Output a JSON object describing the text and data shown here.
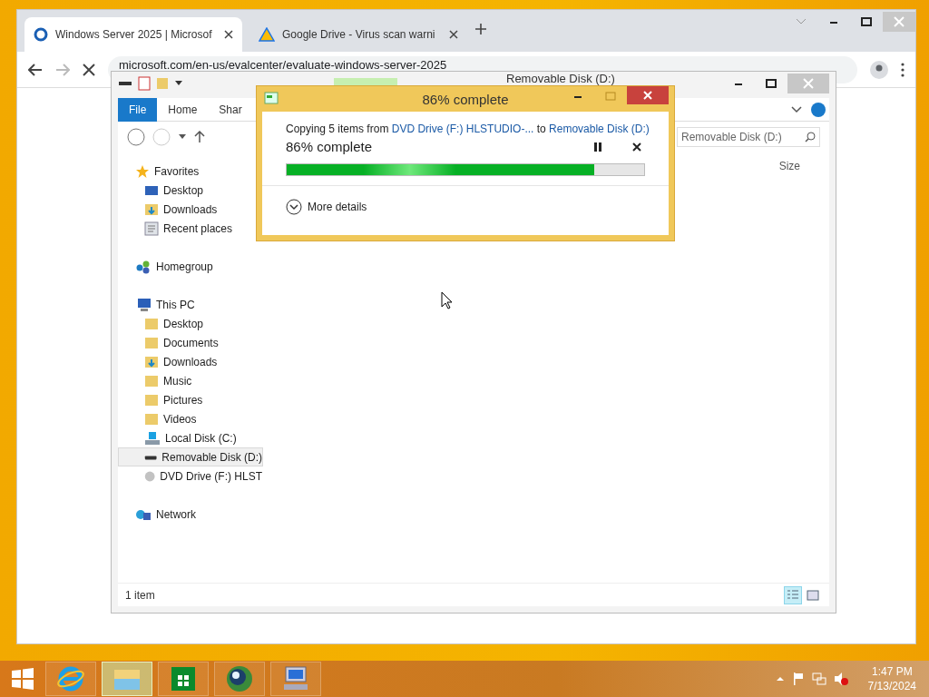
{
  "browser": {
    "tabs": [
      {
        "title": "Windows Server 2025 | Microsof",
        "selected": true,
        "kind": "ring"
      },
      {
        "title": "Google Drive - Virus scan warni",
        "selected": false,
        "kind": "drive"
      }
    ],
    "url": "microsoft.com/en-us/evalcenter/evaluate-windows-server-2025"
  },
  "explorer": {
    "title": "Removable Disk (D:)",
    "ribbon_tabs": [
      {
        "label": "File",
        "selected": true
      },
      {
        "label": "Home",
        "selected": false
      },
      {
        "label": "Shar",
        "selected": false
      }
    ],
    "search": {
      "placeholder": "Removable Disk (D:)"
    },
    "columns": [
      "Size"
    ],
    "nav": [
      {
        "label": "Favorites",
        "kind": "star",
        "selected": false,
        "children": [
          {
            "label": "Desktop",
            "kind": "desktop",
            "selected": false
          },
          {
            "label": "Downloads",
            "kind": "downloads",
            "selected": false
          },
          {
            "label": "Recent places",
            "kind": "recent",
            "selected": false
          }
        ]
      },
      {
        "label": "Homegroup",
        "kind": "homegroup",
        "selected": false
      },
      {
        "label": "This PC",
        "kind": "pc",
        "selected": false,
        "children": [
          {
            "label": "Desktop",
            "kind": "folder",
            "selected": false
          },
          {
            "label": "Documents",
            "kind": "folder",
            "selected": false
          },
          {
            "label": "Downloads",
            "kind": "downloads",
            "selected": false
          },
          {
            "label": "Music",
            "kind": "folder",
            "selected": false
          },
          {
            "label": "Pictures",
            "kind": "folder",
            "selected": false
          },
          {
            "label": "Videos",
            "kind": "folder",
            "selected": false
          },
          {
            "label": "Local Disk (C:)",
            "kind": "windisk",
            "selected": false
          },
          {
            "label": "Removable Disk (D:)",
            "kind": "removable",
            "selected": true
          },
          {
            "label": "DVD Drive (F:) HLST",
            "kind": "dvd",
            "selected": false
          }
        ]
      },
      {
        "label": "Network",
        "kind": "network",
        "selected": false
      }
    ],
    "status": "1 item",
    "views": [
      {
        "kind": "details",
        "selected": true
      },
      {
        "kind": "tiles",
        "selected": false
      }
    ]
  },
  "dialog": {
    "title": "86% complete",
    "prefix": "Copying 5 items from ",
    "source": "DVD Drive (F:) HLSTUDIO-...",
    "middle": " to ",
    "destination": "Removable Disk (D:)",
    "heading": "86% complete",
    "level": 0.86,
    "more": "More details"
  },
  "taskbar": {
    "apps": [
      {
        "kind": "ie",
        "selected": false
      },
      {
        "kind": "explorer",
        "selected": true
      },
      {
        "kind": "store",
        "selected": false
      },
      {
        "kind": "globe",
        "selected": false
      },
      {
        "kind": "computer",
        "selected": false
      }
    ],
    "time": "1:47 PM",
    "date": "7/13/2024"
  }
}
